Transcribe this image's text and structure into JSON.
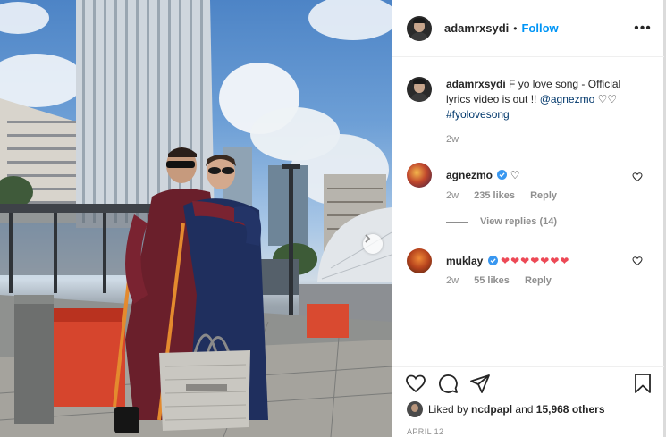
{
  "post": {
    "username": "adamrxsydi",
    "separator": "•",
    "follow_label": "Follow",
    "more_label": "•••",
    "caption": {
      "username": "adamrxsydi",
      "text": "F yo love song - Official lyrics video is out !! ",
      "mention": "@agnezmo",
      "emoji": "♡♡",
      "hashtag": "#fyolovesong",
      "time": "2w"
    },
    "comments": [
      {
        "username": "agnezmo",
        "verified": true,
        "text": "♡",
        "time": "2w",
        "likes": "235 likes",
        "reply_label": "Reply"
      },
      {
        "username": "muklay",
        "verified": true,
        "text": "❤❤❤❤❤❤❤",
        "time": "2w",
        "likes": "55 likes",
        "reply_label": "Reply"
      }
    ],
    "view_replies_label": "View replies (14)",
    "liked_by": {
      "prefix": "Liked by ",
      "user": "ncdpapl",
      "middle": " and ",
      "others": "15,968 others"
    },
    "date": "APRIL 12"
  },
  "colors": {
    "accent": "#0095f6",
    "heart_red": "#ed4956",
    "verified": "#3897f0",
    "text": "#262626",
    "muted": "#8e8e8e"
  },
  "icons": [
    "chevron-right-icon",
    "more-icon",
    "verified-badge-icon",
    "heart-icon",
    "comment-icon",
    "share-icon",
    "bookmark-icon"
  ]
}
